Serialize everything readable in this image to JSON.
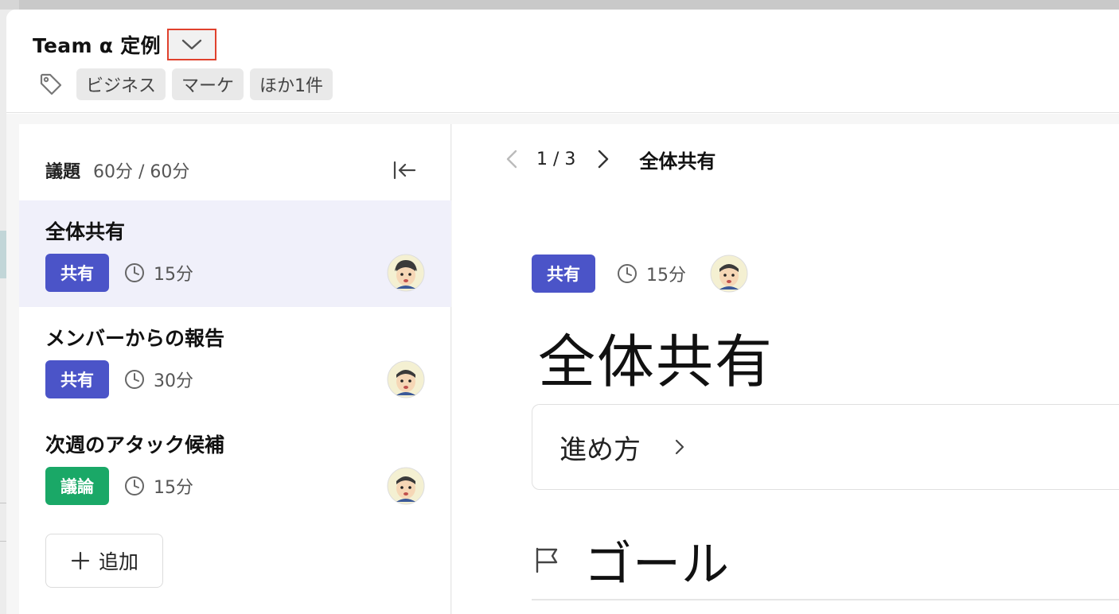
{
  "header": {
    "title": "Team α 定例",
    "tags": [
      "ビジネス",
      "マーケ",
      "ほか1件"
    ]
  },
  "agenda": {
    "heading": "議題",
    "time_summary": "60分 / 60分",
    "add_label": "追加",
    "items": [
      {
        "title": "全体共有",
        "badge": "共有",
        "badge_type": "share",
        "minutes": "15分",
        "selected": true
      },
      {
        "title": "メンバーからの報告",
        "badge": "共有",
        "badge_type": "share",
        "minutes": "30分",
        "selected": false
      },
      {
        "title": "次週のアタック候補",
        "badge": "議論",
        "badge_type": "discuss",
        "minutes": "15分",
        "selected": false
      }
    ]
  },
  "detail": {
    "pager_text": "1 / 3",
    "pager_title": "全体共有",
    "badge": "共有",
    "minutes": "15分",
    "title": "全体共有",
    "howto_label": "進め方",
    "goal_label": "ゴール"
  },
  "colors": {
    "share_badge": "#4b54c8",
    "discuss_badge": "#1aa867",
    "selected_row": "#f0f0fa",
    "highlight_border": "#e0412d"
  }
}
